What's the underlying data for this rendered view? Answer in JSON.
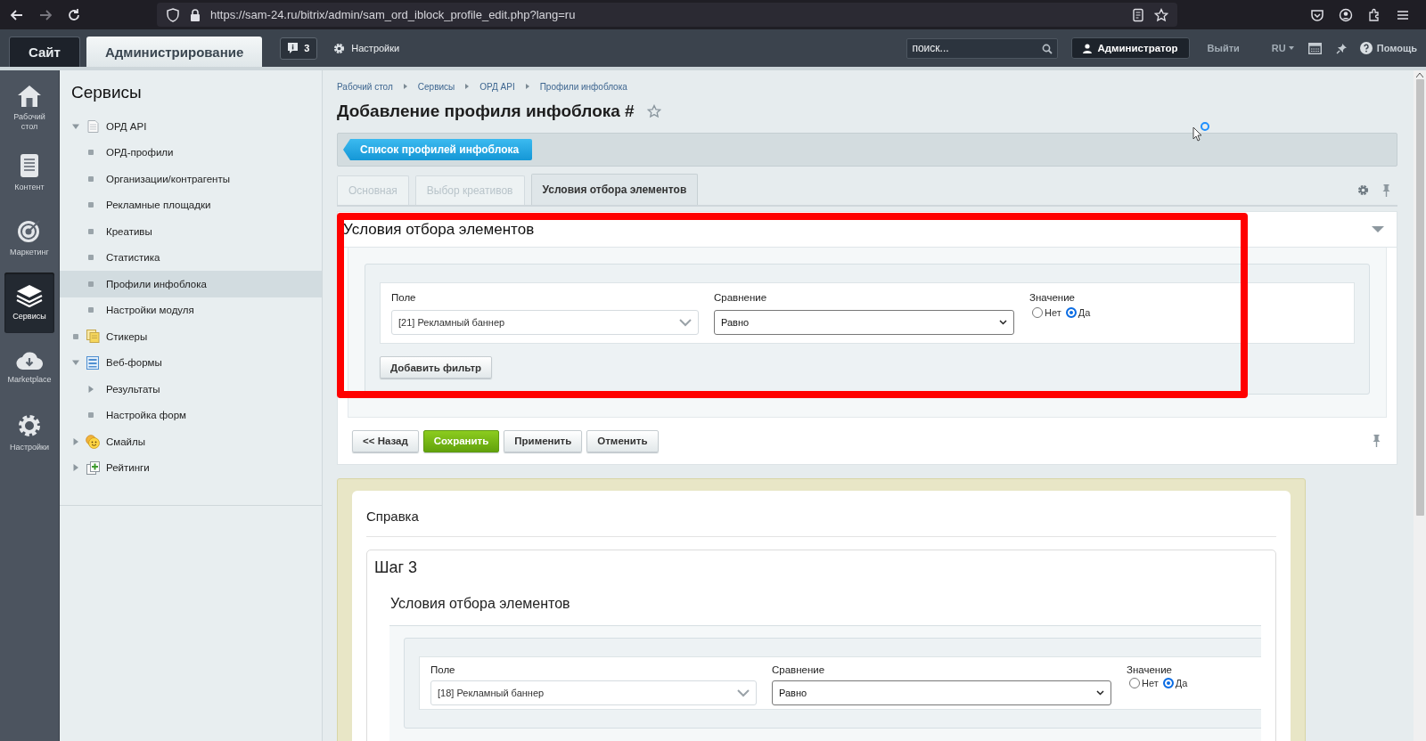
{
  "browser": {
    "url": "https://sam-24.ru/bitrix/admin/sam_ord_iblock_profile_edit.php?lang=ru"
  },
  "admin_header": {
    "tabs": [
      {
        "label": "Сайт",
        "selected": false
      },
      {
        "label": "Администрирование",
        "selected": true
      }
    ],
    "notifications": "3",
    "settings": "Настройки",
    "search": {
      "placeholder": "поиск..."
    },
    "user": "Администратор",
    "logout": "Выйти",
    "language": "RU",
    "help": "Помощь"
  },
  "side_nav": [
    {
      "label": "Рабочий стол",
      "selected": false
    },
    {
      "label": "Контент",
      "selected": false
    },
    {
      "label": "Маркетинг",
      "selected": false
    },
    {
      "label": "Сервисы",
      "selected": true
    },
    {
      "label": "Marketplace",
      "selected": false
    },
    {
      "label": "Настройки",
      "selected": false
    }
  ],
  "menu": {
    "title": "Сервисы",
    "items": [
      {
        "label": "ОРД API",
        "kind": "branch",
        "expanded": true,
        "selected": false,
        "children": [
          {
            "label": "ОРД-профили",
            "kind": "leaf",
            "selected": false
          },
          {
            "label": "Организации/контрагенты",
            "kind": "leaf",
            "selected": false
          },
          {
            "label": "Рекламные площадки",
            "kind": "leaf",
            "selected": false
          },
          {
            "label": "Креативы",
            "kind": "leaf",
            "selected": false
          },
          {
            "label": "Статистика",
            "kind": "leaf",
            "selected": false
          },
          {
            "label": "Профили инфоблока",
            "kind": "leaf",
            "selected": true
          },
          {
            "label": "Настройки модуля",
            "kind": "leaf",
            "selected": false
          }
        ]
      },
      {
        "label": "Стикеры",
        "kind": "leaf",
        "selected": false
      },
      {
        "label": "Веб-формы",
        "kind": "branch",
        "expanded": true,
        "selected": false,
        "children": [
          {
            "label": "Результаты",
            "kind": "branch",
            "expanded": false,
            "selected": false
          },
          {
            "label": "Настройка форм",
            "kind": "leaf",
            "selected": false
          }
        ]
      },
      {
        "label": "Смайлы",
        "kind": "branch",
        "expanded": false,
        "selected": false
      },
      {
        "label": "Рейтинги",
        "kind": "branch",
        "expanded": false,
        "selected": false
      }
    ]
  },
  "breadcrumbs": [
    "Рабочий стол",
    "Сервисы",
    "ОРД API",
    "Профили инфоблока"
  ],
  "page_title": "Добавление профиля инфоблока #",
  "back_link": "Список профилей инфоблока",
  "tabs": [
    {
      "label": "Основная",
      "selected": false,
      "disabled": true
    },
    {
      "label": "Выбор креативов",
      "selected": false,
      "disabled": true
    },
    {
      "label": "Условия отбора элементов",
      "selected": true,
      "disabled": false
    }
  ],
  "section": {
    "title": "Условия отбора элементов",
    "highlighted": true,
    "filters": [
      {
        "field_label": "Поле",
        "field_value": "[21] Рекламный баннер",
        "comparison_label": "Сравнение",
        "comparison_value": "Равно",
        "value_label": "Значение",
        "options": [
          {
            "label": "Нет",
            "selected": false
          },
          {
            "label": "Да",
            "selected": true
          }
        ]
      }
    ],
    "add_filter": "Добавить фильтр"
  },
  "actions": [
    {
      "label": "<< Назад",
      "kind": "default"
    },
    {
      "label": "Сохранить",
      "kind": "primary"
    },
    {
      "label": "Применить",
      "kind": "default"
    },
    {
      "label": "Отменить",
      "kind": "default"
    }
  ],
  "help": {
    "title": "Справка",
    "step": {
      "title": "Шаг 3",
      "section_title": "Условия отбора элементов",
      "filter": {
        "field_label": "Поле",
        "field_value": "[18] Рекламный баннер",
        "comparison_label": "Сравнение",
        "comparison_value": "Равно",
        "value_label": "Значение",
        "options": [
          {
            "label": "Нет",
            "selected": false
          },
          {
            "label": "Да",
            "selected": true
          }
        ]
      }
    }
  }
}
